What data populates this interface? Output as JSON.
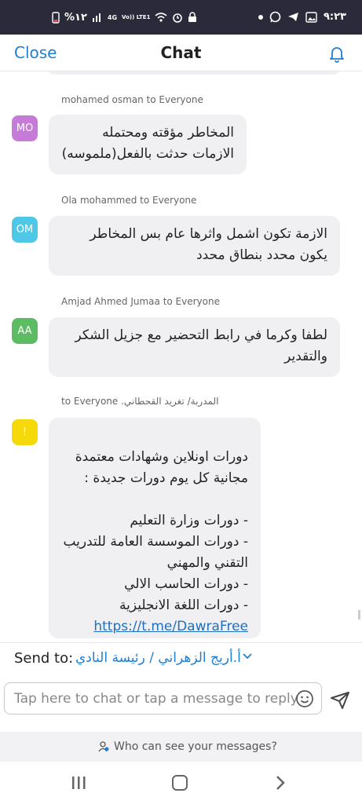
{
  "status_bar": {
    "left_text": "%١٢",
    "network": "4G",
    "volte": "Vo)) LTE1",
    "time": "٩:٢٣"
  },
  "header": {
    "close_label": "Close",
    "title": "Chat"
  },
  "messages": [
    {
      "sender": "mohamed osman to Everyone",
      "avatar": "MO",
      "avatar_color": "#c77bd9",
      "text": "المخاطر مؤقته ومحتمله\nالازمات حدثت بالفعل(ملموسه)"
    },
    {
      "sender": "Ola mohammed to Everyone",
      "avatar": "OM",
      "avatar_color": "#4fc7e6",
      "text": "الازمة تكون اشمل واثرها عام  بس المخاطر\nيكون محدد بنطاق محدد"
    },
    {
      "sender": "Amjad Ahmed Jumaa to Everyone",
      "avatar": "AA",
      "avatar_color": "#5dbb63",
      "text": "لطفا وكرما في رابط التحضير مع جزيل الشكر\nوالتقدير"
    },
    {
      "sender": "المدربة/ تغريد القحطاني. to Everyone",
      "avatar": "!",
      "avatar_color": "#f5d90a",
      "text": "دورات اونلاين وشهادات معتمدة\nمجانية كل يوم دورات جديدة :\n\n- دورات وزارة التعليم\n- دورات الموسسة العامة للتدريب\nالتقني والمهني\n- دورات الحاسب الالي\n- دورات اللغة الانجليزية\n",
      "link": "https://t.me/DawraFree"
    }
  ],
  "send_to": {
    "label": "Send to:",
    "value": "أ.أريج الزهراني / رئيسة النادي"
  },
  "input": {
    "placeholder": "Tap here to chat or tap a message to reply"
  },
  "footer": {
    "who_can_see": "Who can see your messages?"
  },
  "colors": {
    "accent": "#1f7fd2",
    "bubble": "#f0f0f2"
  }
}
